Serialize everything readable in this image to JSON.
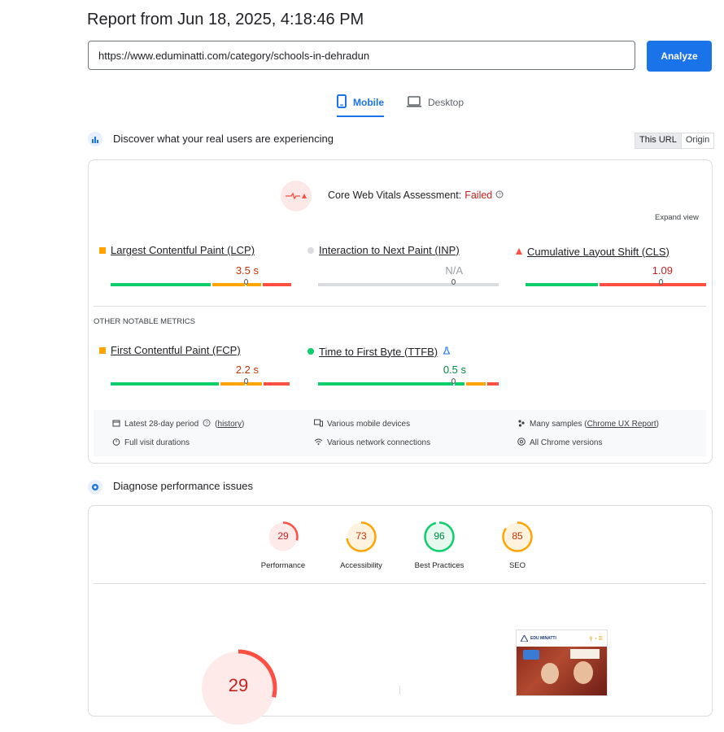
{
  "header": {
    "title": "Report from Jun 18, 2025, 4:18:46 PM"
  },
  "search": {
    "url_value": "https://www.eduminatti.com/category/schools-in-dehradun",
    "analyze_label": "Analyze"
  },
  "tabs": [
    {
      "label": "Mobile",
      "icon": "phone-icon",
      "active": true
    },
    {
      "label": "Desktop",
      "icon": "monitor-icon",
      "active": false
    }
  ],
  "field_section": {
    "title": "Discover what your real users are experiencing",
    "toggle": {
      "this_url": "This URL",
      "origin": "Origin"
    },
    "assessment_label": "Core Web Vitals Assessment:",
    "assessment_result": "Failed",
    "expand_view": "Expand view",
    "metrics": [
      {
        "name": "Largest Contentful Paint (LCP)",
        "value": "3.5 s",
        "status": "needs-improvement",
        "marker_fraction": 0.75,
        "color": "#ffa400"
      },
      {
        "name": "Interaction to Next Paint (INP)",
        "value": "N/A",
        "status": "no-data",
        "marker_fraction": 0.75,
        "color": "#bdc1c6"
      },
      {
        "name": "Cumulative Layout Shift (CLS)",
        "value": "1.09",
        "status": "poor",
        "marker_fraction": 0.75,
        "color": "#ff4e42"
      }
    ],
    "other_metrics_heading": "OTHER NOTABLE METRICS",
    "other_metrics": [
      {
        "name": "First Contentful Paint (FCP)",
        "value": "2.2 s",
        "status": "needs-improvement",
        "marker_fraction": 0.75,
        "color": "#ffa400"
      },
      {
        "name": "Time to First Byte (TTFB)",
        "value": "0.5 s",
        "status": "good",
        "marker_fraction": 0.75,
        "color": "#0cce6b"
      }
    ],
    "footer": {
      "period": "Latest 28-day period",
      "history": "history",
      "durations": "Full visit durations",
      "devices": "Various mobile devices",
      "network": "Various network connections",
      "samples_prefix": "Many samples (",
      "samples_link": "Chrome UX Report",
      "samples_suffix": ")",
      "chrome_versions": "All Chrome versions"
    }
  },
  "lab_section": {
    "title": "Diagnose performance issues",
    "scores": [
      {
        "label": "Performance",
        "score": "29",
        "fraction": 0.29,
        "color": "#ff4e42",
        "bg": "#ffeaea"
      },
      {
        "label": "Accessibility",
        "score": "73",
        "fraction": 0.73,
        "color": "#ffa400",
        "bg": "#fff3e0"
      },
      {
        "label": "Best Practices",
        "score": "96",
        "fraction": 0.96,
        "color": "#0cce6b",
        "bg": "#e6f9ee"
      },
      {
        "label": "SEO",
        "score": "85",
        "fraction": 0.85,
        "color": "#ffa400",
        "bg": "#fff3e0"
      }
    ],
    "big_score": "29",
    "big_fraction": 0.29,
    "thumbnail_brand": "EDU MINATTI"
  }
}
